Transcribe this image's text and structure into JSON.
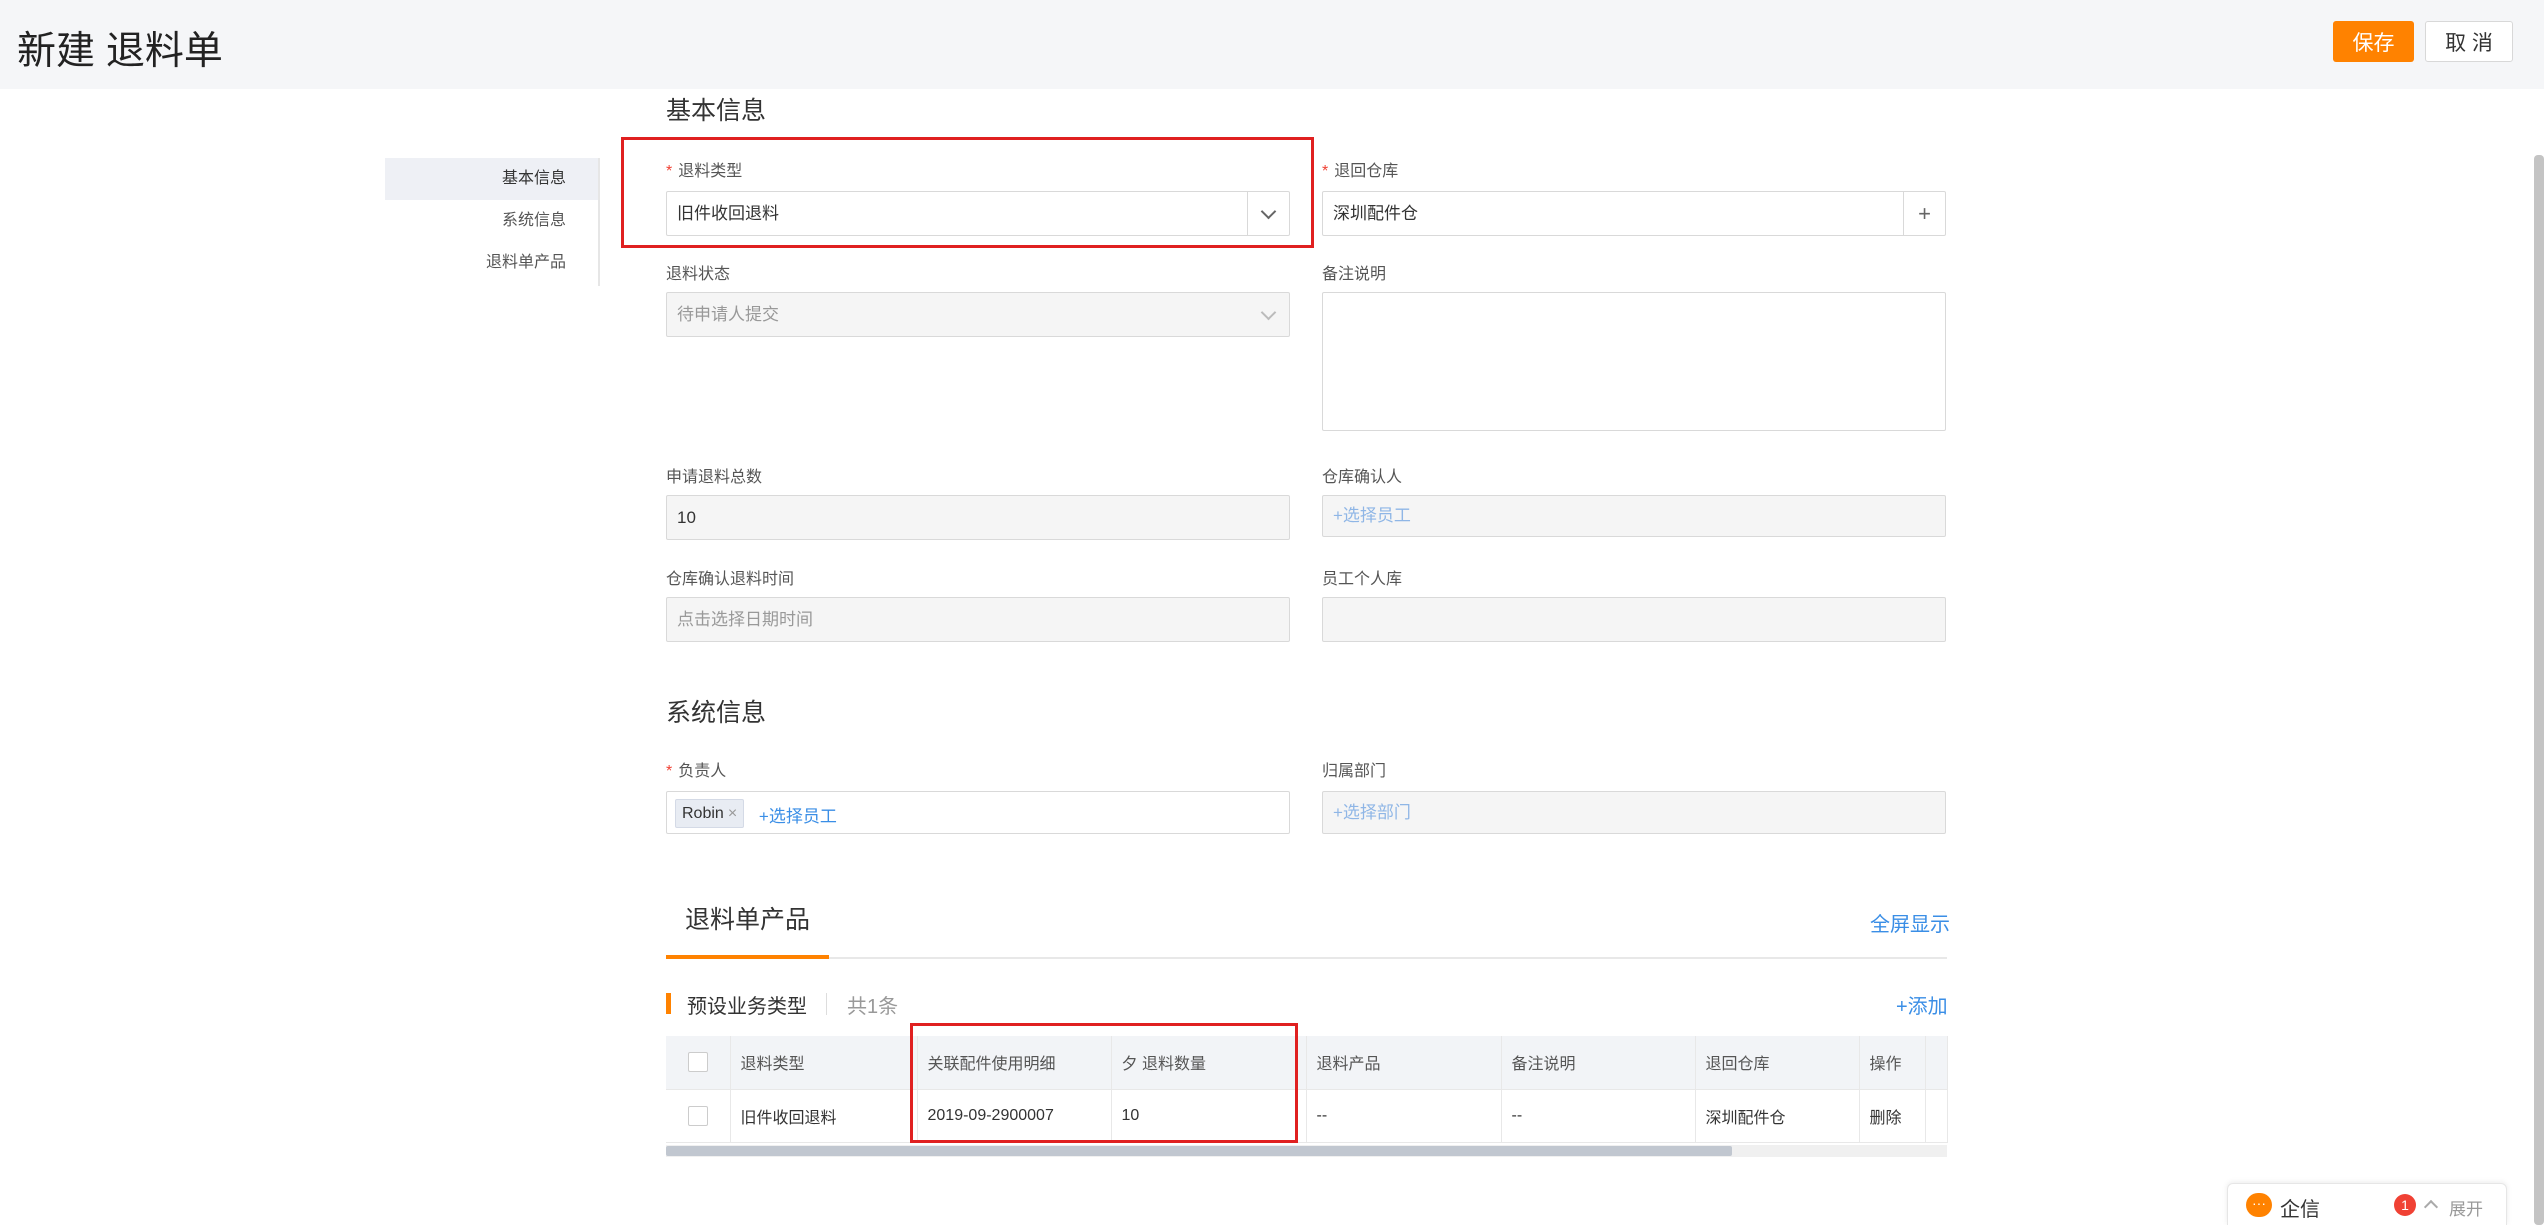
{
  "header": {
    "title": "新建 退料单",
    "save_label": "保存",
    "cancel_label": "取 消"
  },
  "side_nav": {
    "items": [
      {
        "label": "基本信息",
        "active": true
      },
      {
        "label": "系统信息",
        "active": false
      },
      {
        "label": "退料单产品",
        "active": false
      }
    ]
  },
  "basic_info": {
    "section_title": "基本信息",
    "return_type": {
      "label": "退料类型",
      "value": "旧件收回退料",
      "required": true
    },
    "return_warehouse": {
      "label": "退回仓库",
      "value": "深圳配件仓",
      "required": true
    },
    "return_status": {
      "label": "退料状态",
      "value": "待申请人提交"
    },
    "remarks": {
      "label": "备注说明",
      "value": ""
    },
    "total_qty": {
      "label": "申请退料总数",
      "value": "10"
    },
    "warehouse_confirmer": {
      "label": "仓库确认人",
      "placeholder": "+选择员工"
    },
    "confirm_time": {
      "label": "仓库确认退料时间",
      "placeholder": "点击选择日期时间"
    },
    "personal_store": {
      "label": "员工个人库",
      "value": ""
    }
  },
  "system_info": {
    "section_title": "系统信息",
    "owner": {
      "label": "负责人",
      "required": true,
      "tag": "Robin",
      "tag_close": "×",
      "add_label": "+选择员工"
    },
    "department": {
      "label": "归属部门",
      "placeholder": "+选择部门"
    }
  },
  "products": {
    "tab_label": "退料单产品",
    "fullscreen_label": "全屏显示",
    "subhead": "预设业务类型",
    "count_label": "共1条",
    "add_label": "+添加",
    "columns": [
      "退料类型",
      "关联配件使用明细",
      "夕 退料数量",
      "退料产品",
      "备注说明",
      "退回仓库",
      "操作"
    ],
    "rows": [
      {
        "return_type": "旧件收回退料",
        "usage_detail": "2019-09-2900007",
        "quantity": "10",
        "product": "--",
        "remarks": "--",
        "warehouse": "深圳配件仓",
        "action": "删除"
      }
    ]
  },
  "chat_widget": {
    "icon": "chat-bubble-icon",
    "label": "企信",
    "badge": "1",
    "expand_label": "展开"
  },
  "colors": {
    "accent": "#ff8200",
    "link": "#3a8ee6",
    "highlight_box": "#e02020",
    "required": "#f04134"
  }
}
